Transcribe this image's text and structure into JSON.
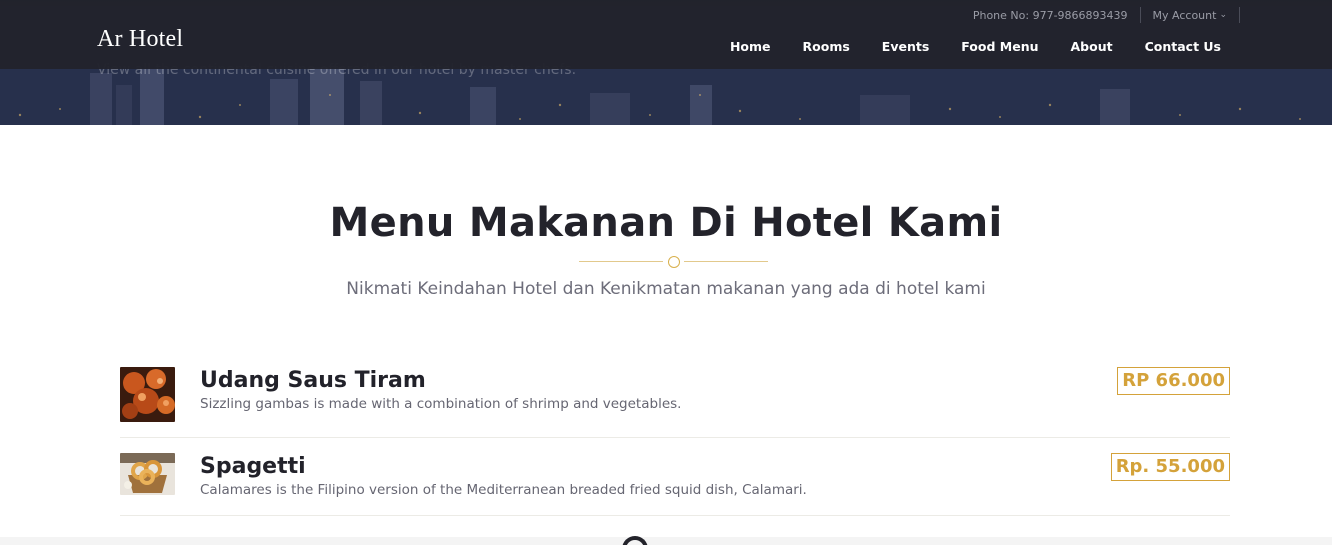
{
  "hero": {
    "subtitle": "View all the continental cuisine offered in our hotel by master chefs."
  },
  "header": {
    "brand": "Ar Hotel",
    "phone": "Phone No: 977-9866893439",
    "account": "My Account",
    "nav": [
      "Home",
      "Rooms",
      "Events",
      "Food Menu",
      "About",
      "Contact Us"
    ]
  },
  "section": {
    "title": "Menu Makanan Di Hotel Kami",
    "subtitle": "Nikmati Keindahan Hotel dan Kenikmatan makanan yang ada di hotel kami"
  },
  "menu": [
    {
      "name": "Udang Saus Tiram",
      "description": "Sizzling gambas is made with a combination of shrimp and vegetables.",
      "price": "RP 66.000"
    },
    {
      "name": "Spagetti",
      "description": "Calamares is the Filipino version of the Mediterranean breaded fried squid dish, Calamari.",
      "price": "Rp. 55.000"
    }
  ],
  "colors": {
    "accent": "#d4a23a",
    "header_bg": "#22232c",
    "heading": "#23232b"
  }
}
